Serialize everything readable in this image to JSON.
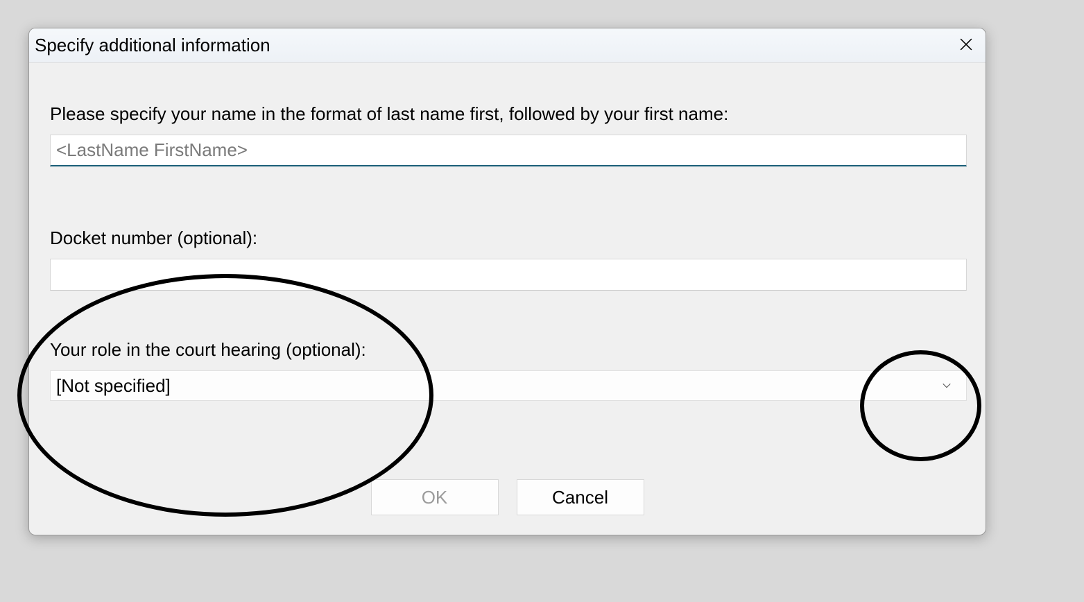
{
  "dialog": {
    "title": "Specify additional information",
    "name_label": "Please specify your name in the format of last name first, followed by your first name:",
    "name_placeholder": "<LastName FirstName>",
    "name_value": "",
    "docket_label": "Docket number (optional):",
    "docket_value": "",
    "role_label": "Your role in the court hearing (optional):",
    "role_selected": "[Not specified]",
    "ok_label": "OK",
    "cancel_label": "Cancel"
  }
}
